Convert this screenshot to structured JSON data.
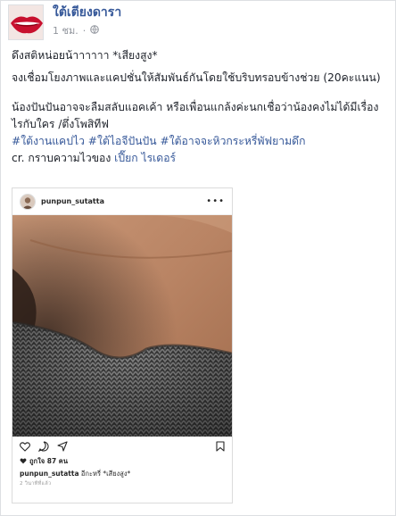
{
  "page": {
    "name": "ใต้เตียงดารา",
    "time": "1 ชม.",
    "time_sep": "·"
  },
  "post": {
    "line1": "ดึงสติหน่อยน้าาาาาา *เสียงสูง*",
    "line2": "จงเชื่อมโยงภาพและแคปชั่นให้สัมพันธ์กันโดยใช้บริบทรอบข้างช่วย (20คะแนน)",
    "line3": "น้องปันปันอาจจะลืมสลับแอคเค้า หรือเพื่อนแกล้งค่ะนกเชื่อว่าน้องคงไม่ได้มีเรื่องไรกับใคร /ตึ่งโพสิทีฟ",
    "hashtags": [
      "#ใต้งานแคปไว",
      "#ใต้ไอจีปันปัน",
      "#ใต้อาจจะหิวกระหรี่พัฟยามดึก"
    ],
    "credit_prefix": "cr. กราบความไวของ",
    "credit_name": "เปี๊ยก ไรเดอร์"
  },
  "instagram": {
    "username": "punpun_sutatta",
    "more": "•••",
    "likes": "ถูกใจ 87 คน",
    "caption_user": "punpun_sutatta",
    "caption_text": "อีกะหรี่ *เสียงสูง*",
    "time": "2 วินาทีที่แล้ว"
  },
  "colors": {
    "link": "#365899",
    "text": "#1d2129",
    "meta": "#90949c",
    "border": "#dddfe2"
  },
  "icons": [
    "globe-icon",
    "heart-icon",
    "comment-icon",
    "share-icon",
    "bookmark-icon",
    "more-icon"
  ]
}
